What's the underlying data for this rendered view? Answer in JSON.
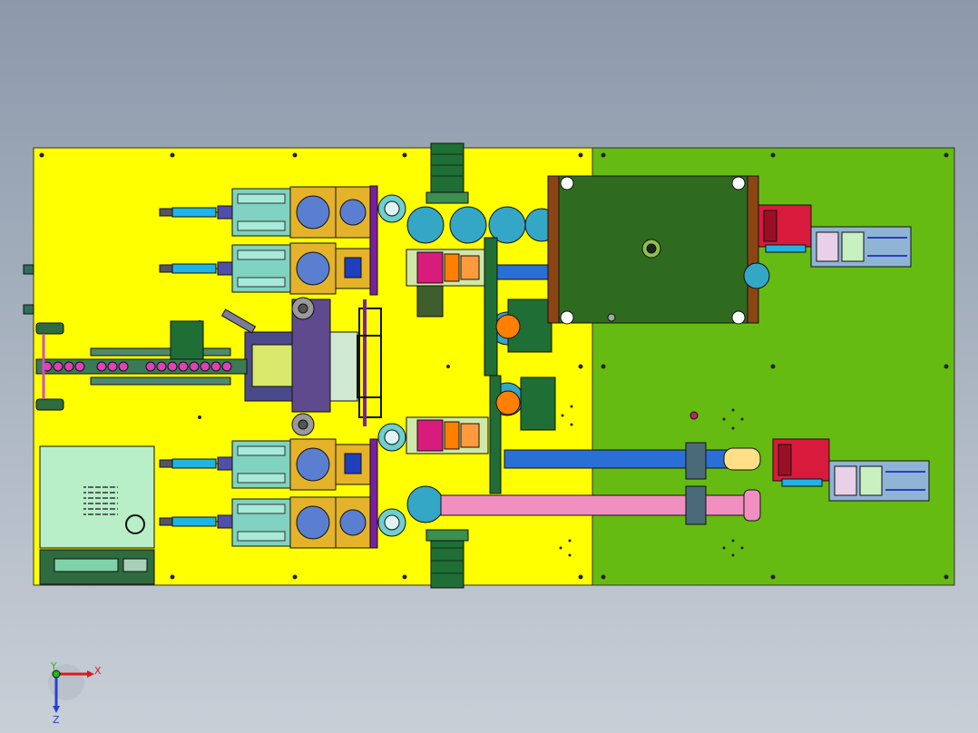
{
  "viewport": {
    "background_top": "#8b99ab",
    "background_bottom": "#c9cfd7"
  },
  "colors": {
    "base_plate_left": "#ffff00",
    "base_plate_right": "#66bb12",
    "feeder_body": "#7fd3c0",
    "motor": "#1f6e35",
    "chassis_brown": "#8b4513",
    "dark_green_panel": "#2e6b1f",
    "belt_blue": "#2a6fd6",
    "belt_pink": "#f08fc0",
    "wheel_cyan": "#34a6c6",
    "clamp_red": "#d81b3c",
    "control_box": "#b8eec8"
  },
  "axis_triad": {
    "x_label": "X",
    "y_label": "Y",
    "z_label": "Z"
  }
}
